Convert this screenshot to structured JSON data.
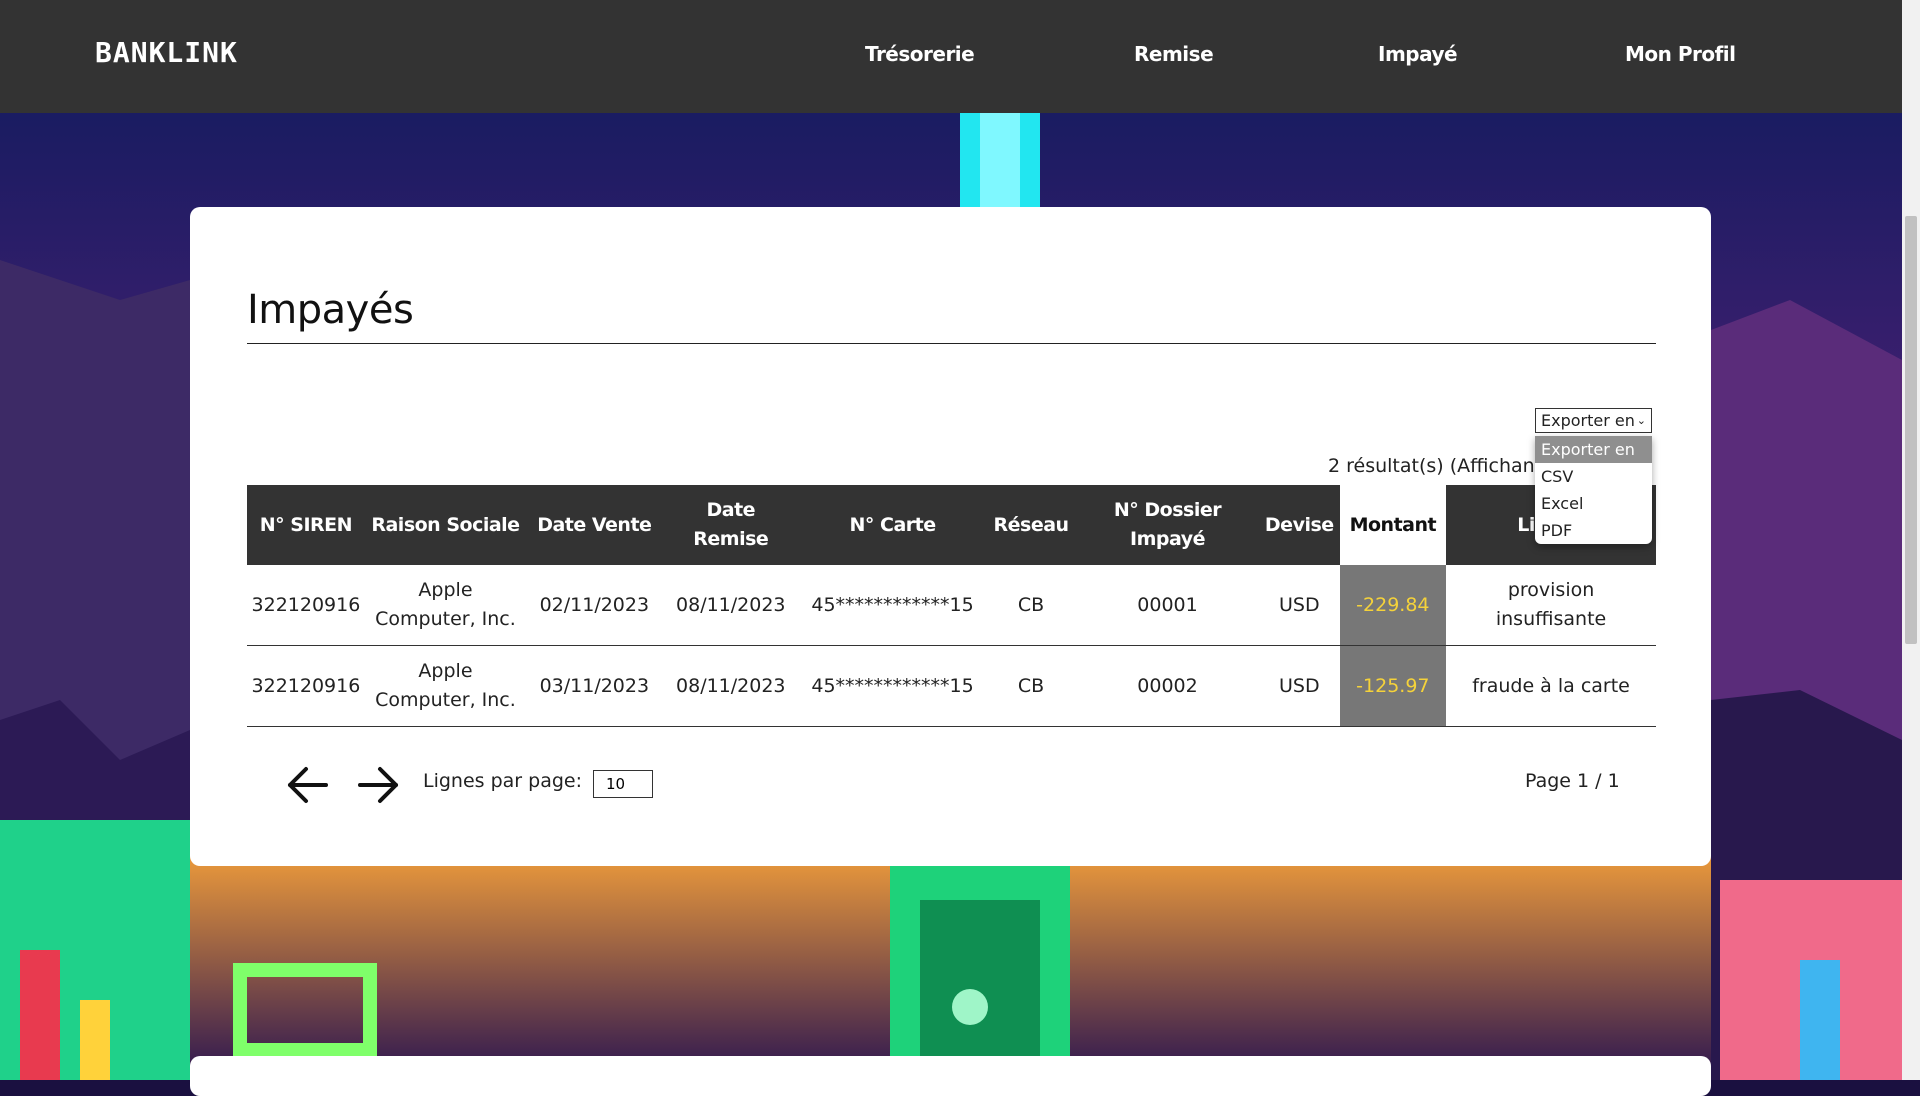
{
  "brand": "BANKLINK",
  "nav": {
    "items": [
      "Trésorerie",
      "Remise",
      "Impayé",
      "Mon Profil"
    ]
  },
  "page": {
    "title": "Impayés",
    "results_text": "2 résultat(s) (Affichant"
  },
  "export": {
    "selected": "Exporter en",
    "options": [
      "Exporter en",
      "CSV",
      "Excel",
      "PDF"
    ]
  },
  "table": {
    "headers": [
      "N° SIREN",
      "Raison Sociale",
      "Date Vente",
      "Date Remise",
      "N° Carte",
      "Réseau",
      "N° Dossier Impayé",
      "Devise",
      "Montant",
      "Libellé"
    ],
    "rows": [
      [
        "322120916",
        "Apple Computer, Inc.",
        "02/11/2023",
        "08/11/2023",
        "45************15",
        "CB",
        "00001",
        "USD",
        "-229.84",
        "provision insuffisante"
      ],
      [
        "322120916",
        "Apple Computer, Inc.",
        "03/11/2023",
        "08/11/2023",
        "45************15",
        "CB",
        "00002",
        "USD",
        "-125.97",
        "fraude à la carte"
      ]
    ]
  },
  "pagination": {
    "rows_label": "Lignes par page:",
    "rows_value": "10",
    "page_text": "Page 1 / 1"
  },
  "colors": {
    "navbar": "#333333",
    "table_header": "#333333",
    "amount_cell_bg": "#777777",
    "amount_text": "#f5d23a"
  }
}
